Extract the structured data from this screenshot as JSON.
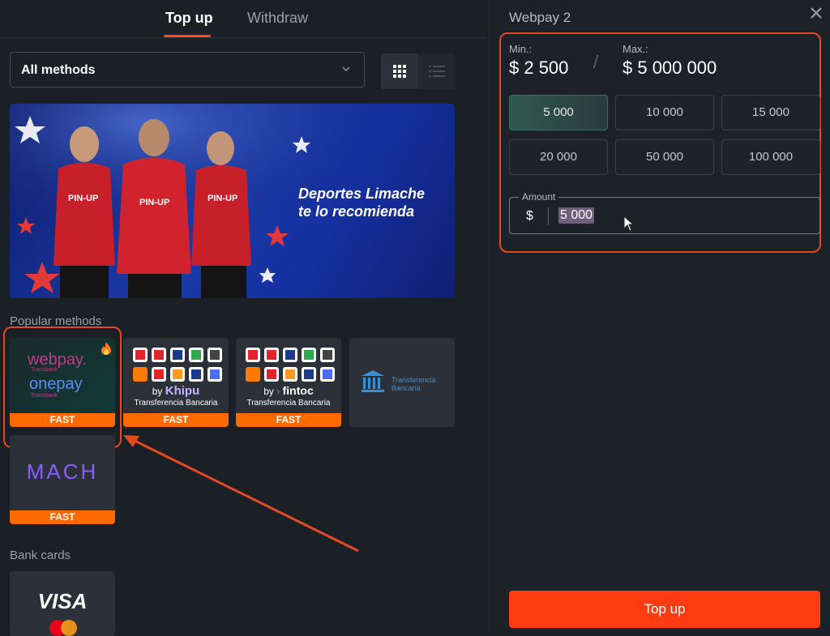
{
  "tabs": [
    {
      "label": "Top up",
      "active": true
    },
    {
      "label": "Withdraw",
      "active": false
    }
  ],
  "filter": {
    "selected": "All methods"
  },
  "banner": {
    "text_line1": "Deportes Limache",
    "text_line2": "te lo recomienda",
    "brand": "PIN-UP"
  },
  "sections": {
    "popular": "Popular methods",
    "bank_cards": "Bank cards"
  },
  "methods": {
    "webpay": {
      "line1": "webpay.",
      "line2": "onepay",
      "sub": "Transbank",
      "badge": "FAST"
    },
    "khipu": {
      "by": "by",
      "brand": "Khipu",
      "caption": "Transferencia Bancaria",
      "badge": "FAST"
    },
    "fintoc": {
      "by": "by",
      "brand": "fintoc",
      "caption": "Transferencia Bancaria",
      "badge": "FAST"
    },
    "transfer": {
      "line1": "Transferencia",
      "line2": "Bancaria"
    },
    "mach": {
      "brand": "MACH",
      "badge": "FAST"
    },
    "visa": {
      "brand": "VISA"
    }
  },
  "panel": {
    "title": "Webpay 2",
    "min_label": "Min.:",
    "min_value": "$ 2 500",
    "slash": "/",
    "max_label": "Max.:",
    "max_value": "$ 5 000 000",
    "amounts": [
      "5 000",
      "10 000",
      "15 000",
      "20 000",
      "50 000",
      "100 000"
    ],
    "active_amount": 0,
    "amount_label": "Amount",
    "currency": "$",
    "amount_value": "5 000",
    "submit_label": "Top up"
  },
  "colors": {
    "accent": "#ff3b12",
    "fast": "#ff6a00",
    "highlight": "#e34a20"
  }
}
